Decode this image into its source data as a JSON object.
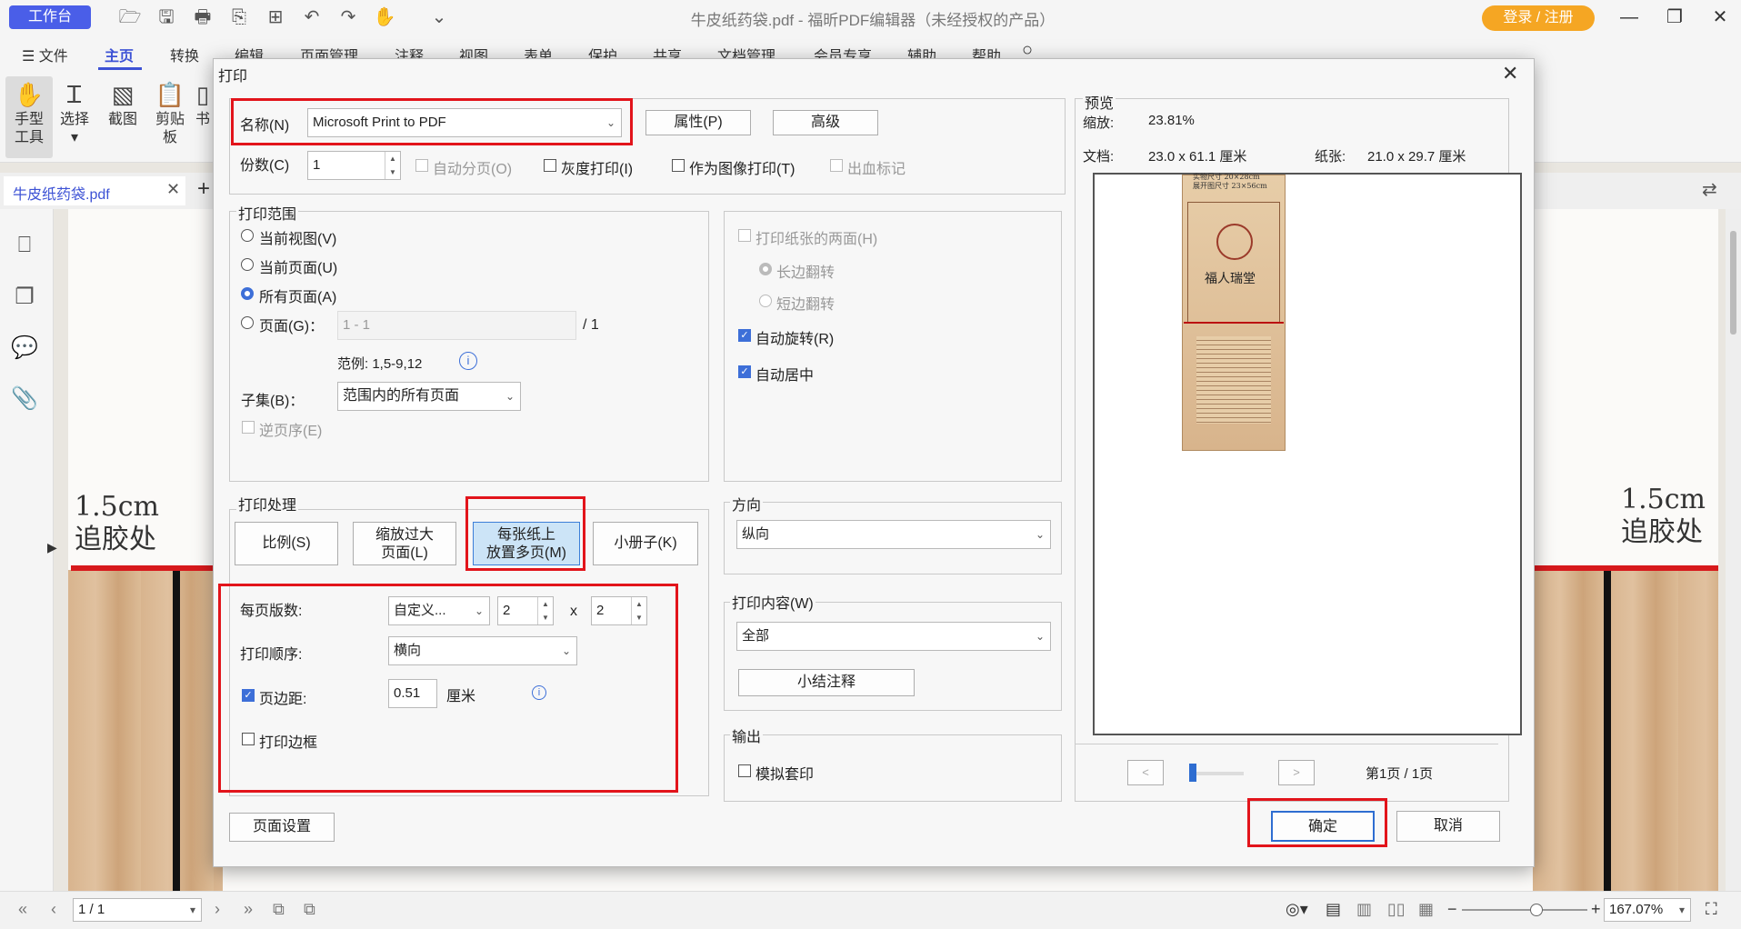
{
  "titlebar": {
    "workbench": "工作台",
    "title": "牛皮纸药袋.pdf - 福昕PDF编辑器（未经授权的产品）",
    "login": "登录 / 注册"
  },
  "menu": {
    "file": "文件",
    "items": [
      "主页",
      "转换",
      "编辑",
      "页面管理",
      "注释",
      "视图",
      "表单",
      "保护",
      "共享",
      "文档管理",
      "会员专享",
      "辅助",
      "帮助"
    ]
  },
  "ribbon": {
    "hand": "手型工具",
    "hand_l1": "手型",
    "hand_l2": "工具",
    "select": "选择",
    "screenshot": "截图",
    "clipboard_l1": "剪贴",
    "clipboard_l2": "板",
    "more": "书"
  },
  "doc_tab": {
    "name": "牛皮纸药袋.pdf"
  },
  "document": {
    "left_note_1": "1.5cm",
    "left_note_2": "追胶处",
    "right_note_1": "1.5cm",
    "right_note_2": "追胶处"
  },
  "statusbar": {
    "page": "1 / 1",
    "zoom": "167.07%"
  },
  "dialog": {
    "title": "打印",
    "printer": {
      "name_label": "名称(N)",
      "name_value": "Microsoft Print to PDF",
      "properties": "属性(P)",
      "advanced": "高级",
      "copies_label": "份数(C)",
      "copies_value": "1",
      "collate": "自动分页(O)",
      "grayscale": "灰度打印(I)",
      "as_image": "作为图像打印(T)",
      "bleed": "出血标记"
    },
    "range": {
      "title": "打印范围",
      "current_view": "当前视图(V)",
      "current_page": "当前页面(U)",
      "all_pages": "所有页面(A)",
      "pages": "页面(G)：",
      "pages_placeholder": "1 - 1",
      "pages_total": "/ 1",
      "example": "范例:  1,5-9,12",
      "subset_label": "子集(B)：",
      "subset_value": "范围内的所有页面",
      "reverse": "逆页序(E)"
    },
    "duplex": {
      "both_sides": "打印纸张的两面(H)",
      "long_edge": "长边翻转",
      "short_edge": "短边翻转",
      "auto_rotate": "自动旋转(R)",
      "auto_center": "自动居中"
    },
    "handling": {
      "title": "打印处理",
      "scale": "比例(S)",
      "shrink_l1": "缩放过大",
      "shrink_l2": "页面(L)",
      "multi_l1": "每张纸上",
      "multi_l2": "放置多页(M)",
      "booklet": "小册子(K)",
      "pages_per_sheet_label": "每页版数:",
      "pages_per_sheet_value": "自定义...",
      "cols": "2",
      "times": "x",
      "rows": "2",
      "order_label": "打印顺序:",
      "order_value": "横向",
      "margin_label": "页边距:",
      "margin_value": "0.51",
      "margin_unit": "厘米",
      "border": "打印边框"
    },
    "orientation": {
      "title": "方向",
      "value": "纵向"
    },
    "content": {
      "title": "打印内容(W)",
      "value": "全部",
      "summarize": "小结注释"
    },
    "output": {
      "title": "输出",
      "simulate": "模拟套印"
    },
    "preview": {
      "title": "预览",
      "zoom_label": "缩放:",
      "zoom_value": "23.81%",
      "doc_label": "文档:",
      "doc_value": "23.0 x 61.1 厘米",
      "paper_label": "纸张:",
      "paper_value": "21.0 x 29.7 厘米",
      "page_indicator": "第1页 / 1页",
      "thumb_line1": "实物尺寸 20×28cm",
      "thumb_line2": "展开图尺寸 23×56cm",
      "thumb_text": "福人瑞堂"
    },
    "page_setup": "页面设置",
    "ok": "确定",
    "cancel": "取消"
  }
}
